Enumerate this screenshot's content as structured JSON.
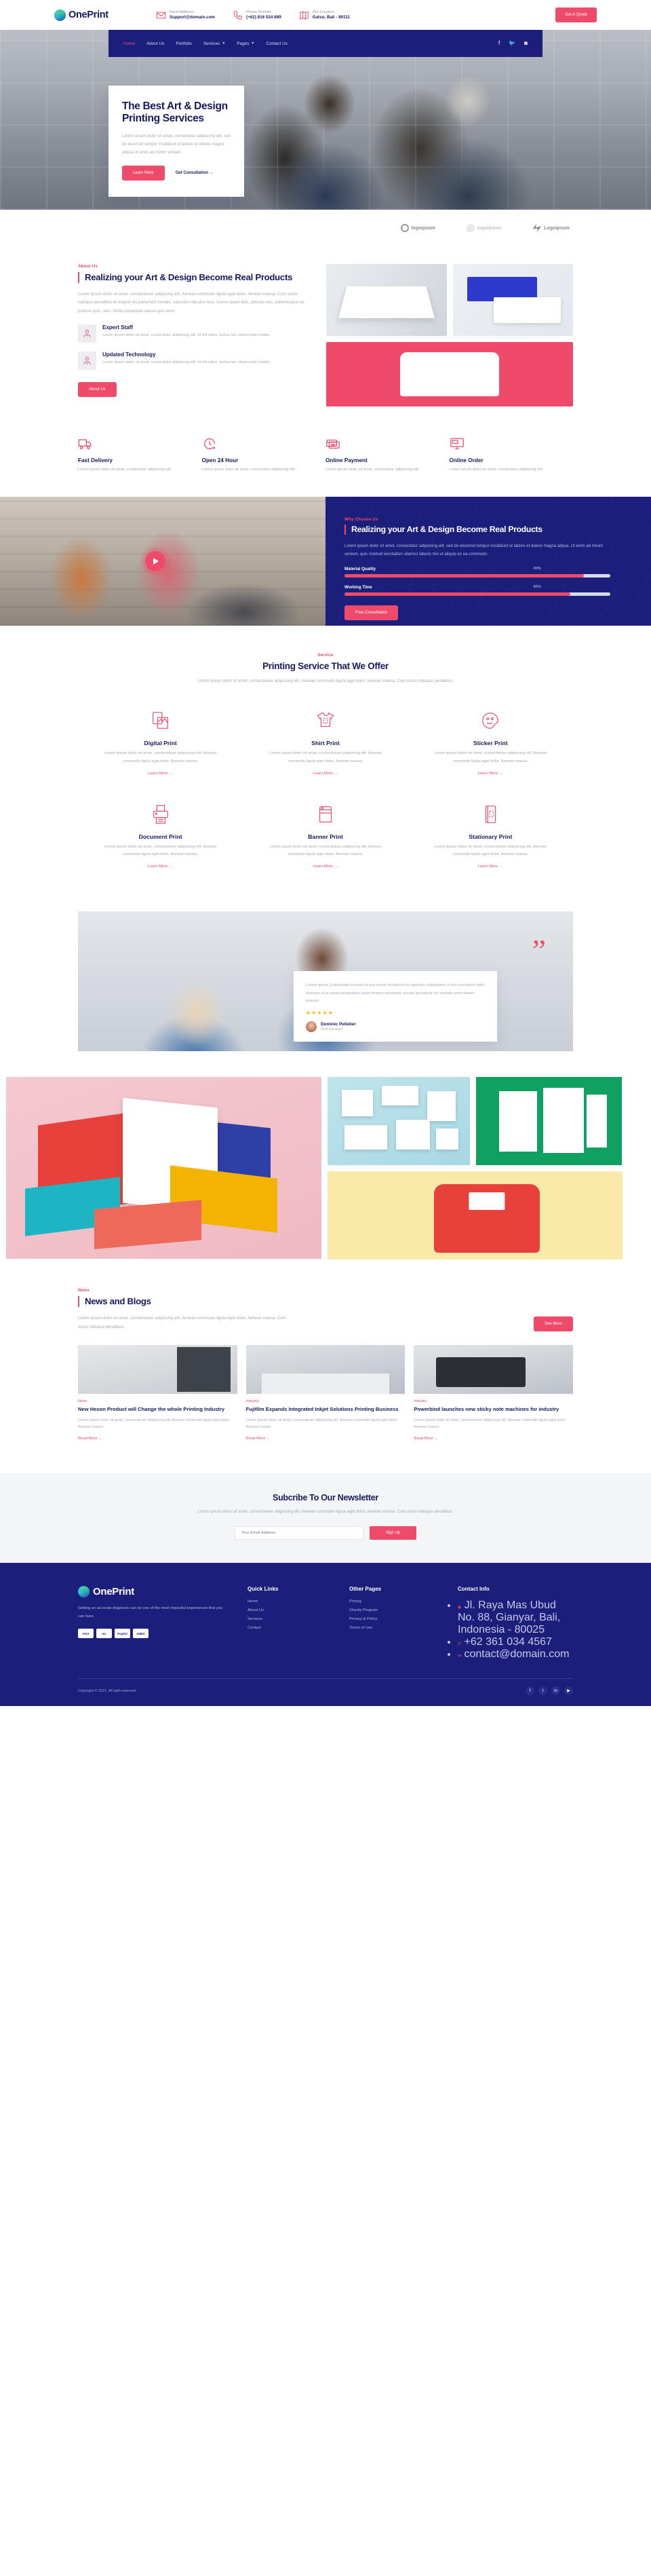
{
  "brand": {
    "name": "OnePrint"
  },
  "topbar": {
    "contacts": [
      {
        "icon": "email-icon",
        "label": "Email Address",
        "value": "Support@domain.com"
      },
      {
        "icon": "phone-icon",
        "label": "Phone Number",
        "value": "(+62) 816 524 689"
      },
      {
        "icon": "map-icon",
        "label": "Our Location",
        "value": "Gatsu, Bali - 80111"
      }
    ],
    "quote_button": "Get A Quote"
  },
  "nav": {
    "items": [
      {
        "label": "Home",
        "active": true,
        "caret": false
      },
      {
        "label": "About Us",
        "active": false,
        "caret": false
      },
      {
        "label": "Portfolio",
        "active": false,
        "caret": false
      },
      {
        "label": "Services",
        "active": false,
        "caret": true
      },
      {
        "label": "Pages",
        "active": false,
        "caret": true
      },
      {
        "label": "Contact Us",
        "active": false,
        "caret": false
      }
    ],
    "socials": [
      "facebook-icon",
      "twitter-icon",
      "instagram-icon"
    ]
  },
  "hero": {
    "title": "The Best Art & Design Printing Services",
    "paragraph": "Lorem ipsum dolor sit amet, consectetur adipiscing elit, sed do eiusmod tempor incididunt ut labore et dolore magna aliqua Ut enim ad minim veniam",
    "primary_button": "Learn More",
    "secondary_link": "Get Consultation  →"
  },
  "clients": [
    {
      "name": "logoipsum",
      "mark": "circle"
    },
    {
      "name": "logoipsum",
      "mark": "blob"
    },
    {
      "name": "Logoipsum",
      "mark": "bolt"
    }
  ],
  "about": {
    "eyebrow": "About Us",
    "title": "Realizing your Art & Design Become Real Products",
    "paragraph": "Lorem ipsum dolor sit amet, consectetuer adipiscing elit. Aenean commodo ligula eget dolor. Aenean massa. Cum sociis natoque penatibus et magnis dis parturient montes, nascetur ridiculus mus. Donec quam felis, ultricies nec, pellentesque eu, pretium quis, sem. Nulla consequat massa quis enim.",
    "features": [
      {
        "icon": "staff-icon",
        "title": "Expert Staff",
        "text": "Lorem ipsum dolor sit amet, consectetur adipiscing elit. Ut elit tellus, luctus nec ullamcorper mattis."
      },
      {
        "icon": "technology-icon",
        "title": "Updated Technology",
        "text": "Lorem ipsum dolor sit amet, consectetur adipiscing elit. Ut elit tellus, luctus nec ullamcorper mattis."
      }
    ],
    "button": "About Us"
  },
  "features": [
    {
      "icon": "truck-icon",
      "title": "Fast Delivery",
      "text": "Lorem ipsum dolor sit amet, consectetur adipiscing elit."
    },
    {
      "icon": "clock-24-icon",
      "title": "Open 24 Hour",
      "text": "Lorem ipsum dolor sit amet, consectetur adipiscing elit."
    },
    {
      "icon": "card-icon",
      "title": "Online Payment",
      "text": "Lorem ipsum dolor sit amet, consectetur adipiscing elit."
    },
    {
      "icon": "monitor-icon",
      "title": "Online Order",
      "text": "Lorem ipsum dolor sit amet, consectetur adipiscing elit."
    }
  ],
  "why": {
    "eyebrow": "Why Choose Us",
    "title": "Realizing your Art & Design Become Real Products",
    "paragraph": "Lorem ipsum dolor sit amet, consectetur adipiscing elit, sed do eiusmod tempor incididunt ut labore et dolore magna aliqua. Ut enim ad minim veniam, quis nostrud xercitation ullamco laboris nisi ut aliquip ex ea commodo",
    "bars": [
      {
        "label": "Material Quality",
        "percent": "90%",
        "value": 90
      },
      {
        "label": "Working Time",
        "percent": "85%",
        "value": 85
      }
    ],
    "button": "Free Consultation",
    "play_button": "play-icon"
  },
  "services": {
    "eyebrow": "Service",
    "title": "Printing Service That We Offer",
    "subtitle": "Lorem ipsum dolor sit amet, consectetuer adipiscing elit. Aenean commodo ligula eget dolor. Aenean massa. Cum sociis natoque penatibus.",
    "items": [
      {
        "icon": "digital-print-icon",
        "title": "Digital Print",
        "text": "Lorem ipsum dolor sit amet, consectetuer adipiscing elit. Aenean commodo ligula eget dolor. Aenean massa.",
        "link": "Learn More  →"
      },
      {
        "icon": "shirt-print-icon",
        "title": "Shirt Print",
        "text": "Lorem ipsum dolor sit amet, consectetuer adipiscing elit. Aenean commodo ligula eget dolor. Aenean massa.",
        "link": "Learn More  →"
      },
      {
        "icon": "sticker-print-icon",
        "title": "Sticker Print",
        "text": "Lorem ipsum dolor sit amet, consectetuer adipiscing elit. Aenean commodo ligula eget dolor. Aenean massa.",
        "link": "Learn More  →"
      },
      {
        "icon": "document-print-icon",
        "title": "Document Print",
        "text": "Lorem ipsum dolor sit amet, consectetuer adipiscing elit. Aenean commodo ligula eget dolor. Aenean massa.",
        "link": "Learn More  →"
      },
      {
        "icon": "banner-print-icon",
        "title": "Banner Print",
        "text": "Lorem ipsum dolor sit amet, consectetuer adipiscing elit. Aenean commodo ligula eget dolor. Aenean massa.",
        "link": "Learn More  →"
      },
      {
        "icon": "stationary-print-icon",
        "title": "Stationary Print",
        "text": "Lorem ipsum dolor sit amet, consectetuer adipiscing elit. Aenean commodo ligula eget dolor. Aenean massa.",
        "link": "Learn More  →"
      }
    ]
  },
  "testimonial": {
    "quote": "Lorem ipsum Quibusdam eveniet ut eos rerum incididunt eu aperiam voluptatem ut non provident dolor dolorum ut et quod voluptatibus quas tempor reiciendis veniam provident hic veritatis exercitation placeat.",
    "stars": "★★★★★",
    "name": "Dominic Pelletier",
    "role": "Web Manager"
  },
  "news": {
    "eyebrow": "News",
    "title": "News and Blogs",
    "paragraph": "Lorem ipsum dolor sit amet, consectetuer adipiscing elit. Aenean commodo ligula eget dolor. Aenean massa. Cum sociis natoque penatibus.",
    "button": "See More",
    "posts": [
      {
        "category": "News",
        "title": "New Hexon Product will Change the whole Printing Industry",
        "text": "Lorem ipsum dolor sit amet, consectetuer adipiscing elit. Aenean commodo ligula eget dolor. Aenean massa.",
        "link": "Read More  →"
      },
      {
        "category": "Industry",
        "title": "Fujifilm Expands Integrated Inkjet Solutions Printing Business",
        "text": "Lorem ipsum dolor sit amet, consectetuer adipiscing elit. Aenean commodo ligula eget dolor. Aenean massa.",
        "link": "Read More  →"
      },
      {
        "category": "Industry",
        "title": "Powerbind launches new sticky note machines for industry",
        "text": "Lorem ipsum dolor sit amet, consectetuer adipiscing elit. Aenean commodo ligula eget dolor. Aenean massa.",
        "link": "Read More  →"
      }
    ]
  },
  "newsletter": {
    "title": "Subcribe To Our Newsletter",
    "text": "Lorem ipsum dolor sit amet, consectetuer adipiscing elit. Aenean commodo ligula eget dolor. Aenean massa. Cum sociis natoque penatibus.",
    "placeholder": "Your Email Address",
    "button": "Sign Up"
  },
  "footer": {
    "about": "Getting an accurate diagnosis can be one of the most impactful experiences that you can have.",
    "payments": [
      "VISA",
      "mc",
      "PayPal",
      "AMEX"
    ],
    "quick_links": {
      "heading": "Quick Links",
      "items": [
        "Home",
        "About Us",
        "Services",
        "Contact"
      ]
    },
    "other_pages": {
      "heading": "Other Pages",
      "items": [
        "Pricing",
        "Charity Program",
        "Privacy & Policy",
        "Terms of Use"
      ]
    },
    "contact": {
      "heading": "Contact Info",
      "items": [
        {
          "icon": "map-pin-icon",
          "value": "Jl. Raya Mas Ubud No. 88, Gianyar, Bali, Indonesia - 80025"
        },
        {
          "icon": "phone-icon",
          "value": "+62 361 034 4567"
        },
        {
          "icon": "mail-icon",
          "value": "contact@domain.com"
        }
      ]
    },
    "copyright": "Copyright © 2021. All right reserved",
    "socials": [
      "facebook-icon",
      "twitter-icon",
      "linkedin-icon",
      "youtube-icon"
    ]
  },
  "colors": {
    "primary": "#1b1f7b",
    "accent": "#ef4a6a",
    "star": "#fbb615"
  }
}
